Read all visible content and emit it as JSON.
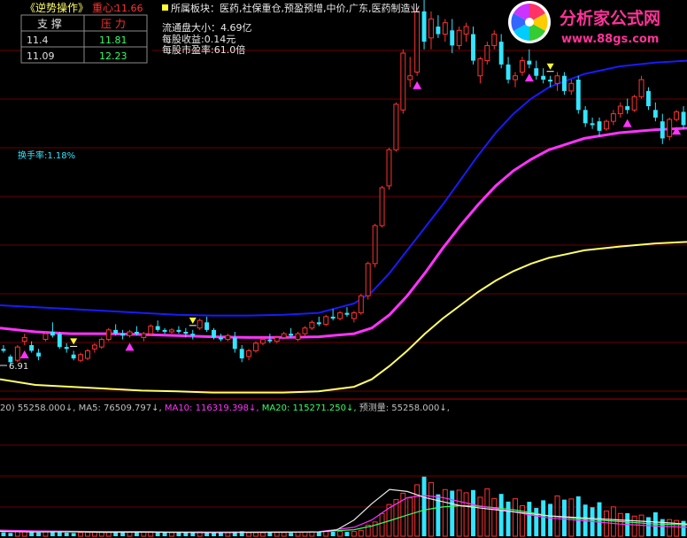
{
  "indicator": {
    "name": "《逆势操作》",
    "center_label": "重心:",
    "center_value": "11.66",
    "support_header": "支 撑",
    "resistance_header": "压 力",
    "rows": [
      {
        "support": "11.4",
        "resistance": "11.81"
      },
      {
        "support": "11.09",
        "resistance": "12.23"
      }
    ]
  },
  "info": {
    "sector": "所属板块：医药,社保重仓,预盈预增,中价,广东,医药制造业",
    "float_cap": "流通盘大小：4.69亿",
    "eps": "每股收益:0.14元",
    "pe": "每股市盈率:61.0倍",
    "turnover": "换手率:1.18%",
    "low_marker": "6.91"
  },
  "watermark": {
    "brand": "分析家公式网",
    "url": "www.88gs.com"
  },
  "volume_legend": [
    {
      "text": "20)",
      "color": "#c0c0c0"
    },
    {
      "text": "55258.000↓,",
      "color": "#c0c0c0"
    },
    {
      "text": "MA5: 76509.797↓,",
      "color": "#c0c0c0"
    },
    {
      "text": "MA10: 116319.398↓,",
      "color": "#ff33ff"
    },
    {
      "text": "MA20: 115271.250↓,",
      "color": "#33ff66"
    },
    {
      "text": "预测量: 55258.000↓,",
      "color": "#c0c0c0"
    }
  ],
  "colors": {
    "up": "#ff3333",
    "down": "#33e5ff",
    "ma_blue": "#1a1aff",
    "ma_magenta": "#ff33ff",
    "ma_yellow": "#ffff66",
    "vol_ma10": "#ff33ff",
    "vol_ma20": "#33ff66",
    "grid": "#6b0000"
  },
  "chart_data": {
    "type": "candlestick",
    "y_unit": "price",
    "ylim": [
      6.0,
      16.5
    ],
    "volume_ylim": [
      0,
      300000
    ],
    "candles": [
      [
        7.3,
        7.4,
        7.2,
        7.25
      ],
      [
        7.1,
        7.15,
        6.85,
        6.95
      ],
      [
        7.0,
        7.4,
        6.95,
        7.35
      ],
      [
        7.5,
        7.7,
        7.4,
        7.6
      ],
      [
        7.4,
        7.5,
        7.2,
        7.25
      ],
      [
        7.2,
        7.3,
        7.0,
        7.1
      ],
      [
        7.55,
        7.75,
        7.5,
        7.7
      ],
      [
        7.75,
        8.0,
        7.6,
        7.65
      ],
      [
        7.7,
        7.75,
        7.3,
        7.35
      ],
      [
        7.35,
        7.45,
        7.2,
        7.3
      ],
      [
        7.15,
        7.25,
        7.0,
        7.05
      ],
      [
        7.0,
        7.2,
        6.95,
        7.15
      ],
      [
        7.05,
        7.3,
        7.0,
        7.25
      ],
      [
        7.3,
        7.45,
        7.2,
        7.4
      ],
      [
        7.35,
        7.6,
        7.3,
        7.55
      ],
      [
        7.55,
        7.85,
        7.5,
        7.8
      ],
      [
        7.8,
        7.95,
        7.65,
        7.7
      ],
      [
        7.7,
        7.8,
        7.55,
        7.65
      ],
      [
        7.65,
        7.8,
        7.6,
        7.75
      ],
      [
        7.75,
        7.9,
        7.65,
        7.7
      ],
      [
        7.6,
        7.75,
        7.5,
        7.7
      ],
      [
        7.7,
        7.95,
        7.65,
        7.9
      ],
      [
        7.9,
        8.05,
        7.75,
        7.8
      ],
      [
        7.8,
        7.85,
        7.7,
        7.75
      ],
      [
        7.75,
        7.85,
        7.7,
        7.8
      ],
      [
        7.8,
        7.9,
        7.7,
        7.75
      ],
      [
        7.75,
        7.85,
        7.6,
        7.7
      ],
      [
        7.7,
        7.8,
        7.55,
        7.65
      ],
      [
        7.85,
        8.1,
        7.8,
        8.05
      ],
      [
        8.0,
        8.15,
        7.75,
        7.8
      ],
      [
        7.8,
        7.85,
        7.55,
        7.6
      ],
      [
        7.6,
        7.7,
        7.5,
        7.55
      ],
      [
        7.55,
        7.7,
        7.5,
        7.65
      ],
      [
        7.6,
        7.75,
        7.2,
        7.3
      ],
      [
        7.3,
        7.4,
        6.95,
        7.05
      ],
      [
        7.1,
        7.3,
        7.0,
        7.25
      ],
      [
        7.25,
        7.5,
        7.2,
        7.45
      ],
      [
        7.45,
        7.6,
        7.4,
        7.55
      ],
      [
        7.55,
        7.7,
        7.45,
        7.5
      ],
      [
        7.5,
        7.65,
        7.45,
        7.6
      ],
      [
        7.6,
        7.75,
        7.55,
        7.7
      ],
      [
        7.7,
        7.85,
        7.6,
        7.65
      ],
      [
        7.55,
        7.75,
        7.5,
        7.7
      ],
      [
        7.7,
        7.9,
        7.65,
        7.85
      ],
      [
        7.85,
        8.05,
        7.8,
        8.0
      ],
      [
        8.0,
        8.15,
        7.9,
        7.95
      ],
      [
        7.95,
        8.2,
        7.9,
        8.15
      ],
      [
        8.15,
        8.35,
        8.05,
        8.1
      ],
      [
        8.1,
        8.3,
        8.05,
        8.25
      ],
      [
        8.25,
        8.4,
        8.15,
        8.2
      ],
      [
        8.1,
        8.3,
        8.0,
        8.25
      ],
      [
        8.25,
        8.75,
        8.2,
        8.7
      ],
      [
        8.7,
        9.6,
        8.6,
        9.55
      ],
      [
        9.55,
        10.6,
        9.45,
        10.55
      ],
      [
        10.55,
        11.6,
        10.5,
        11.55
      ],
      [
        11.6,
        12.6,
        11.5,
        12.55
      ],
      [
        12.55,
        13.8,
        12.5,
        13.75
      ],
      [
        13.6,
        15.2,
        13.5,
        15.1
      ],
      [
        14.4,
        15.0,
        14.2,
        14.5
      ],
      [
        14.6,
        16.3,
        14.5,
        16.2
      ],
      [
        16.2,
        16.5,
        15.2,
        15.4
      ],
      [
        15.5,
        16.2,
        15.2,
        16.0
      ],
      [
        15.8,
        16.1,
        15.5,
        15.6
      ],
      [
        15.6,
        16.0,
        15.4,
        15.9
      ],
      [
        15.7,
        16.0,
        15.1,
        15.3
      ],
      [
        15.3,
        15.8,
        15.2,
        15.7
      ],
      [
        15.6,
        15.9,
        15.4,
        15.8
      ],
      [
        15.6,
        15.8,
        14.8,
        14.9
      ],
      [
        14.5,
        15.0,
        14.3,
        14.95
      ],
      [
        14.9,
        15.4,
        14.8,
        15.3
      ],
      [
        15.3,
        15.7,
        15.2,
        15.6
      ],
      [
        15.4,
        15.6,
        14.7,
        14.8
      ],
      [
        14.8,
        15.0,
        14.3,
        14.4
      ],
      [
        14.4,
        14.6,
        14.2,
        14.5
      ],
      [
        14.6,
        15.0,
        14.5,
        14.9
      ],
      [
        14.9,
        15.2,
        14.7,
        14.8
      ],
      [
        14.7,
        14.9,
        14.4,
        14.5
      ],
      [
        14.5,
        14.7,
        14.3,
        14.4
      ],
      [
        14.4,
        14.5,
        14.2,
        14.35
      ],
      [
        14.3,
        14.6,
        14.1,
        14.5
      ],
      [
        14.5,
        14.6,
        14.0,
        14.1
      ],
      [
        14.1,
        14.4,
        14.0,
        14.3
      ],
      [
        14.4,
        14.5,
        13.5,
        13.6
      ],
      [
        13.6,
        13.7,
        13.15,
        13.25
      ],
      [
        13.25,
        13.4,
        13.1,
        13.2
      ],
      [
        13.3,
        13.4,
        12.9,
        13.05
      ],
      [
        13.1,
        13.35,
        13.05,
        13.3
      ],
      [
        13.3,
        13.6,
        13.2,
        13.5
      ],
      [
        13.5,
        13.8,
        13.4,
        13.7
      ],
      [
        13.7,
        13.9,
        13.5,
        13.6
      ],
      [
        13.6,
        14.0,
        13.55,
        13.95
      ],
      [
        13.95,
        14.5,
        13.9,
        14.4
      ],
      [
        14.1,
        14.2,
        13.6,
        13.7
      ],
      [
        13.6,
        13.8,
        13.3,
        13.4
      ],
      [
        13.3,
        13.5,
        12.7,
        12.85
      ],
      [
        12.9,
        13.4,
        12.8,
        13.35
      ],
      [
        13.35,
        13.6,
        13.3,
        13.55
      ],
      [
        13.55,
        13.7,
        13.1,
        13.2
      ]
    ],
    "volume": [
      9500,
      8200,
      12500,
      13000,
      10500,
      9300,
      11200,
      12800,
      9700,
      8700,
      7900,
      8900,
      9400,
      9800,
      10600,
      11800,
      10200,
      9300,
      10800,
      9100,
      9900,
      11400,
      10700,
      8700,
      9100,
      8900,
      9400,
      8800,
      11000,
      10300,
      9700,
      9000,
      8600,
      11600,
      12600,
      8800,
      9000,
      8600,
      9400,
      9100,
      8800,
      8400,
      10100,
      10600,
      11300,
      9800,
      11800,
      10900,
      12000,
      10600,
      11700,
      14400,
      27300,
      35100,
      55800,
      78000,
      90300,
      105600,
      94200,
      126300,
      146300,
      131900,
      102900,
      114600,
      112000,
      113200,
      106700,
      113500,
      95800,
      116400,
      92800,
      103900,
      85000,
      92000,
      75100,
      84600,
      69500,
      88300,
      79500,
      99000,
      89900,
      91600,
      98000,
      77700,
      71100,
      83500,
      61900,
      72100,
      55900,
      56700,
      49400,
      51900,
      46800,
      58700,
      42100,
      40900,
      38800,
      37700
    ],
    "ma_blue": [
      [
        0,
        8.45
      ],
      [
        40,
        8.4
      ],
      [
        80,
        8.35
      ],
      [
        120,
        8.3
      ],
      [
        160,
        8.25
      ],
      [
        200,
        8.2
      ],
      [
        240,
        8.18
      ],
      [
        280,
        8.18
      ],
      [
        320,
        8.2
      ],
      [
        360,
        8.25
      ],
      [
        400,
        8.5
      ],
      [
        420,
        8.8
      ],
      [
        440,
        9.3
      ],
      [
        460,
        9.9
      ],
      [
        480,
        10.5
      ],
      [
        500,
        11.1
      ],
      [
        520,
        11.75
      ],
      [
        540,
        12.4
      ],
      [
        560,
        13.0
      ],
      [
        580,
        13.5
      ],
      [
        600,
        13.9
      ],
      [
        620,
        14.2
      ],
      [
        660,
        14.55
      ],
      [
        700,
        14.75
      ],
      [
        740,
        14.85
      ],
      [
        776,
        14.9
      ]
    ],
    "ma_magenta": [
      [
        0,
        7.85
      ],
      [
        40,
        7.75
      ],
      [
        80,
        7.7
      ],
      [
        120,
        7.7
      ],
      [
        160,
        7.68
      ],
      [
        200,
        7.65
      ],
      [
        240,
        7.62
      ],
      [
        280,
        7.6
      ],
      [
        320,
        7.6
      ],
      [
        360,
        7.62
      ],
      [
        400,
        7.7
      ],
      [
        420,
        7.85
      ],
      [
        440,
        8.2
      ],
      [
        460,
        8.7
      ],
      [
        480,
        9.3
      ],
      [
        500,
        9.95
      ],
      [
        520,
        10.55
      ],
      [
        540,
        11.1
      ],
      [
        560,
        11.6
      ],
      [
        580,
        12.0
      ],
      [
        600,
        12.3
      ],
      [
        620,
        12.55
      ],
      [
        660,
        12.85
      ],
      [
        700,
        13.0
      ],
      [
        740,
        13.08
      ],
      [
        776,
        13.12
      ]
    ],
    "ma_yellow": [
      [
        0,
        6.5
      ],
      [
        40,
        6.35
      ],
      [
        80,
        6.3
      ],
      [
        120,
        6.25
      ],
      [
        160,
        6.2
      ],
      [
        200,
        6.18
      ],
      [
        240,
        6.15
      ],
      [
        280,
        6.15
      ],
      [
        320,
        6.15
      ],
      [
        360,
        6.18
      ],
      [
        400,
        6.3
      ],
      [
        420,
        6.5
      ],
      [
        440,
        6.85
      ],
      [
        460,
        7.25
      ],
      [
        480,
        7.7
      ],
      [
        500,
        8.1
      ],
      [
        520,
        8.45
      ],
      [
        540,
        8.8
      ],
      [
        560,
        9.1
      ],
      [
        580,
        9.35
      ],
      [
        600,
        9.55
      ],
      [
        620,
        9.7
      ],
      [
        660,
        9.9
      ],
      [
        700,
        10.0
      ],
      [
        740,
        10.08
      ],
      [
        776,
        10.12
      ]
    ],
    "vol_ma5": [
      [
        0,
        12000
      ],
      [
        40,
        10500
      ],
      [
        80,
        11000
      ],
      [
        120,
        9500
      ],
      [
        160,
        10000
      ],
      [
        200,
        9500
      ],
      [
        240,
        9000
      ],
      [
        280,
        9500
      ],
      [
        320,
        10000
      ],
      [
        360,
        10500
      ],
      [
        380,
        15000
      ],
      [
        400,
        40000
      ],
      [
        420,
        80000
      ],
      [
        440,
        115000
      ],
      [
        460,
        110000
      ],
      [
        480,
        95000
      ],
      [
        500,
        85000
      ],
      [
        520,
        75000
      ],
      [
        540,
        70000
      ],
      [
        560,
        65000
      ],
      [
        580,
        60000
      ],
      [
        600,
        55000
      ],
      [
        620,
        50000
      ],
      [
        660,
        45000
      ],
      [
        700,
        40000
      ],
      [
        740,
        35000
      ],
      [
        776,
        30000
      ]
    ],
    "vol_ma10": [
      [
        0,
        15000
      ],
      [
        40,
        13000
      ],
      [
        80,
        12000
      ],
      [
        120,
        11000
      ],
      [
        160,
        11000
      ],
      [
        200,
        10500
      ],
      [
        240,
        10000
      ],
      [
        280,
        10000
      ],
      [
        320,
        10500
      ],
      [
        360,
        11000
      ],
      [
        400,
        22000
      ],
      [
        420,
        40000
      ],
      [
        440,
        70000
      ],
      [
        460,
        95000
      ],
      [
        480,
        100000
      ],
      [
        500,
        95000
      ],
      [
        520,
        85000
      ],
      [
        540,
        75000
      ],
      [
        560,
        68000
      ],
      [
        580,
        60000
      ],
      [
        600,
        52000
      ],
      [
        620,
        45000
      ],
      [
        660,
        38000
      ],
      [
        700,
        30000
      ],
      [
        740,
        25000
      ],
      [
        776,
        22000
      ]
    ],
    "vol_ma20": [
      [
        0,
        13000
      ],
      [
        40,
        12500
      ],
      [
        80,
        12000
      ],
      [
        120,
        11500
      ],
      [
        160,
        11000
      ],
      [
        200,
        10500
      ],
      [
        240,
        10200
      ],
      [
        280,
        10000
      ],
      [
        320,
        10200
      ],
      [
        360,
        10800
      ],
      [
        400,
        16000
      ],
      [
        420,
        25000
      ],
      [
        440,
        38000
      ],
      [
        460,
        52000
      ],
      [
        480,
        65000
      ],
      [
        500,
        72000
      ],
      [
        520,
        75000
      ],
      [
        540,
        74000
      ],
      [
        560,
        70000
      ],
      [
        580,
        65000
      ],
      [
        600,
        58000
      ],
      [
        620,
        50000
      ],
      [
        660,
        42000
      ],
      [
        700,
        36000
      ],
      [
        740,
        30000
      ],
      [
        776,
        28000
      ]
    ],
    "buy_markers": [
      3,
      18,
      59,
      75,
      89,
      96
    ],
    "sell_markers": [
      10,
      27,
      60,
      78
    ]
  }
}
